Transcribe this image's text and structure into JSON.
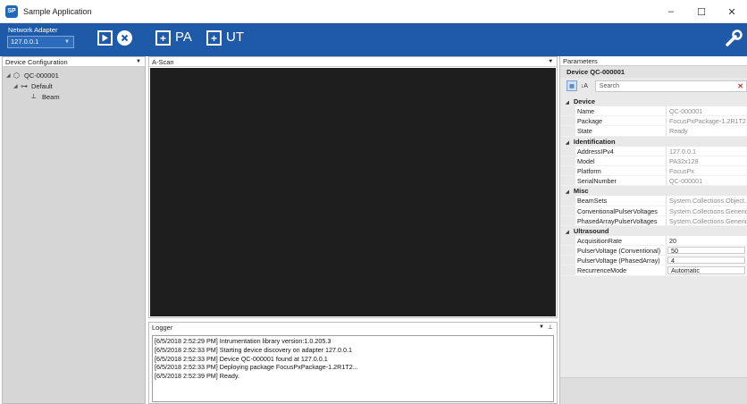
{
  "window": {
    "title": "Sample Application",
    "app_icon_glyph": "SP",
    "controls": {
      "minimize": "–",
      "maximize": "☐",
      "close": "✕"
    }
  },
  "toolbar": {
    "network_adapter_label": "Network Adapter",
    "network_adapter_value": "127.0.0.1",
    "pa_label": "PA",
    "ut_label": "UT",
    "icons": [
      "play-icon",
      "stop-icon",
      "add-pa-icon",
      "add-ut-icon",
      "wrench-icon"
    ]
  },
  "device_config": {
    "header": "Device Configuration",
    "tree": [
      {
        "label": "QC-000001",
        "level": 0,
        "icon": "device-icon"
      },
      {
        "label": "Default",
        "level": 1,
        "icon": "probe-icon"
      },
      {
        "label": "Beam",
        "level": 2,
        "icon": "beam-icon"
      }
    ]
  },
  "ascan": {
    "header": "A-Scan"
  },
  "logger": {
    "header": "Logger",
    "lines": [
      "[6/5/2018 2:52:29 PM] Intrumentation library version:1.0.205.3",
      "[6/5/2018 2:52:33 PM] Starting device discovery on adapter 127.0.0.1",
      "[6/5/2018 2:52:33 PM] Device QC-000001 found at 127.0.0.1",
      "[6/5/2018 2:52:33 PM] Deploying package FocusPxPackage-1.2R1T2...",
      "[6/5/2018 2:52:39 PM] Ready."
    ]
  },
  "parameters": {
    "header": "Parameters",
    "device_title": "Device  QC-000001",
    "search_placeholder": "Search",
    "categories": [
      {
        "name": "Device",
        "props": [
          {
            "name": "Name",
            "value": "QC-000001"
          },
          {
            "name": "Package",
            "value": "FocusPxPackage-1.2R1T2"
          },
          {
            "name": "State",
            "value": "Ready"
          }
        ]
      },
      {
        "name": "Identification",
        "props": [
          {
            "name": "AddressIPv4",
            "value": "127.0.0.1"
          },
          {
            "name": "Model",
            "value": "PA32x128"
          },
          {
            "name": "Platform",
            "value": "FocusPx"
          },
          {
            "name": "SerialNumber",
            "value": "QC-000001"
          }
        ]
      },
      {
        "name": "Misc",
        "props": [
          {
            "name": "BeamSets",
            "value": "System.Collections.Object..."
          },
          {
            "name": "ConventionalPulserVoltages",
            "value": "System.Collections.Generic..."
          },
          {
            "name": "PhasedArrayPulserVoltages",
            "value": "System.Collections.Generic..."
          }
        ]
      },
      {
        "name": "Ultrasound",
        "props": [
          {
            "name": "AcquisitionRate",
            "value": "20"
          },
          {
            "name": "PulserVoltage (Conventional)",
            "value": "50"
          },
          {
            "name": "PulserVoltage (PhasedArray)",
            "value": "4"
          },
          {
            "name": "RecurrenceMode",
            "value": "Automatic"
          }
        ]
      }
    ]
  }
}
